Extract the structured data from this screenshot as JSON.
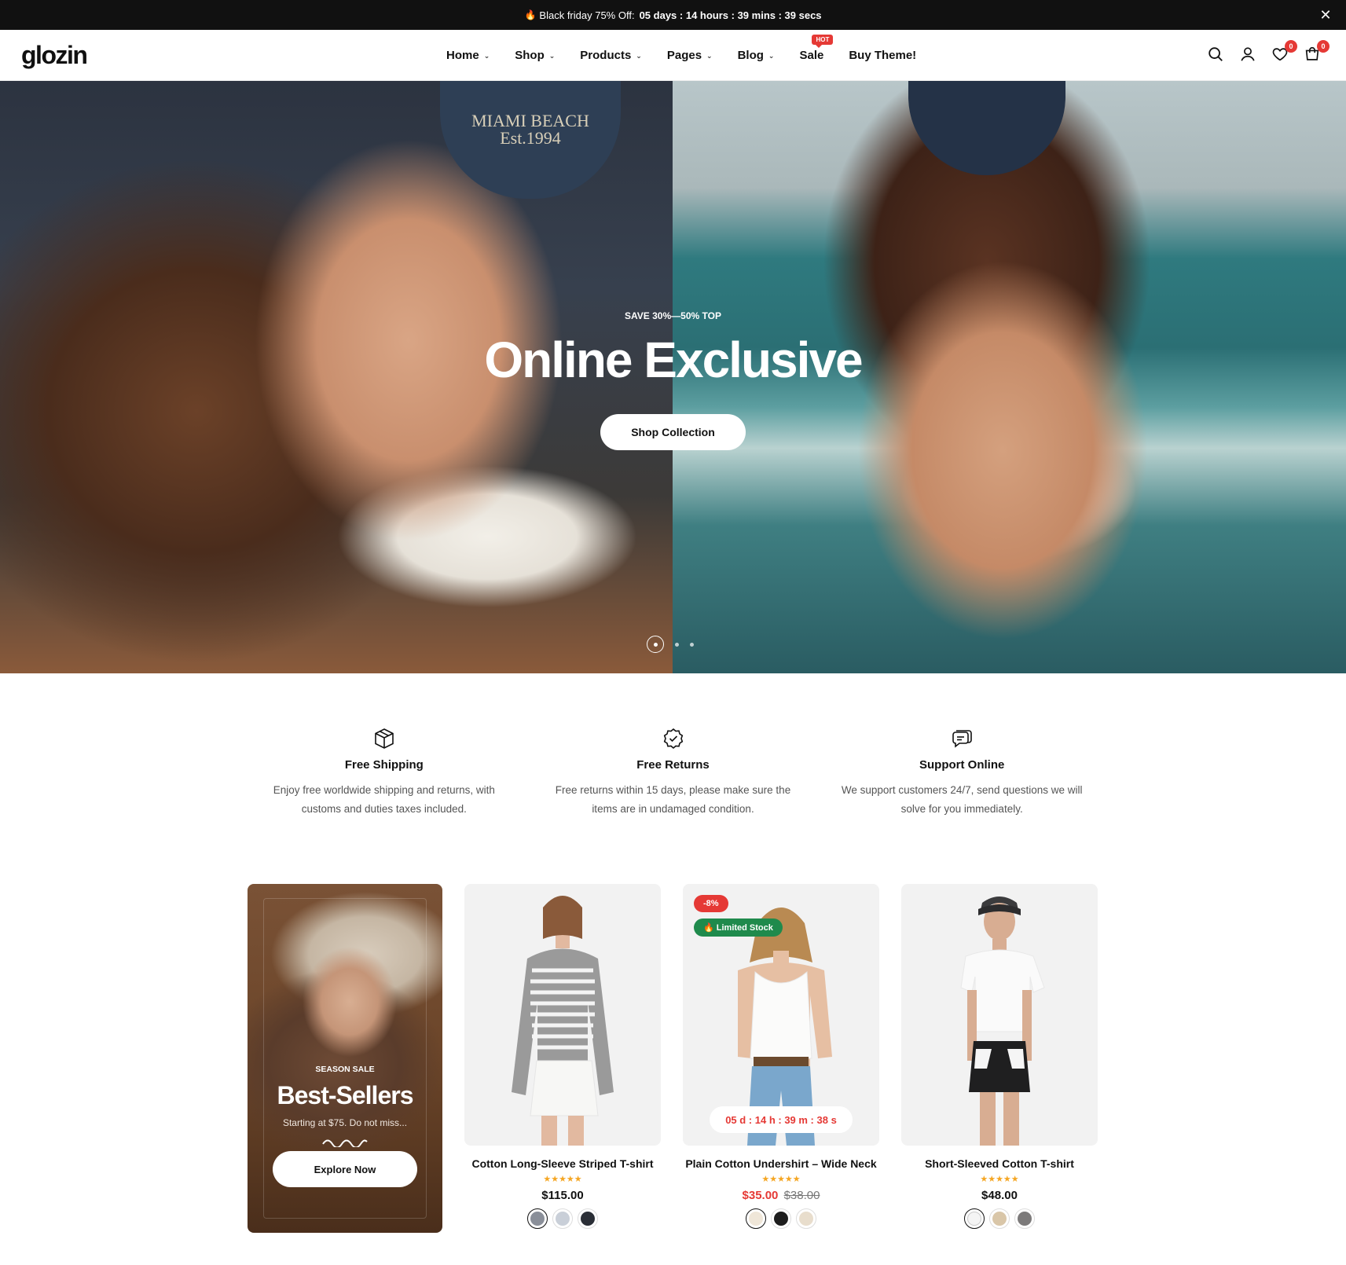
{
  "announcement": {
    "fire_icon": "fire-icon",
    "promo_text": "Black friday 75% Off:",
    "countdown": "05 days : 14 hours : 39 mins : 39 secs",
    "close_icon": "close-icon"
  },
  "header": {
    "logo": "glozin",
    "nav": [
      {
        "label": "Home",
        "has_dropdown": true
      },
      {
        "label": "Shop",
        "has_dropdown": true
      },
      {
        "label": "Products",
        "has_dropdown": true
      },
      {
        "label": "Pages",
        "has_dropdown": true
      },
      {
        "label": "Blog",
        "has_dropdown": true
      },
      {
        "label": "Sale",
        "has_dropdown": false,
        "badge": "HOT"
      },
      {
        "label": "Buy Theme!",
        "has_dropdown": false
      }
    ],
    "icons": {
      "search": "search-icon",
      "account": "user-icon",
      "wishlist": "heart-icon",
      "cart": "cart-icon"
    },
    "wishlist_count": "0",
    "cart_count": "0"
  },
  "hero": {
    "cap_text_line1": "MIAMI BEACH",
    "cap_text_line2": "Est.1994",
    "eyebrow": "SAVE 30%—50% TOP",
    "title": "Online Exclusive",
    "button": "Shop Collection",
    "slides_total": 3,
    "slide_active": 1
  },
  "features": [
    {
      "icon": "box-icon",
      "title": "Free Shipping",
      "desc_line1": "Enjoy free worldwide shipping and returns, with",
      "desc_line2": "customs and duties taxes included."
    },
    {
      "icon": "badge-check-icon",
      "title": "Free Returns",
      "desc_line1": "Free returns within 15 days, please make sure the",
      "desc_line2": "items are in undamaged condition."
    },
    {
      "icon": "chat-icon",
      "title": "Support Online",
      "desc_line1": "We support customers 24/7, send questions we will",
      "desc_line2": "solve for you immediately."
    }
  ],
  "promo_card": {
    "eyebrow": "SEASON SALE",
    "title": "Best-Sellers",
    "subtitle": "Starting at $75. Do not miss...",
    "button": "Explore Now"
  },
  "products": [
    {
      "name": "Cotton Long-Sleeve Striped T-shirt",
      "rating": 5,
      "stars": "★★★★★",
      "price": "$115.00",
      "swatches": [
        "#8a8f99",
        "#c9cfd8",
        "#2a2e36"
      ]
    },
    {
      "name": "Plain Cotton Undershirt – Wide Neck",
      "rating": 5,
      "stars": "★★★★★",
      "price": "$35.00",
      "old_price": "$38.00",
      "sale_badge": "-8%",
      "stock_badge": "Limited Stock",
      "timer": "05 d : 14 h : 39 m : 38 s",
      "swatches": [
        "#efe6d8",
        "#1c1c1c",
        "#e8ddcc"
      ]
    },
    {
      "name": "Short-Sleeved Cotton T-shirt",
      "rating": 5,
      "stars": "★★★★★",
      "price": "$48.00",
      "swatches": [
        "#f4f4f4",
        "#d9c6a8",
        "#7c7a7a"
      ]
    }
  ]
}
